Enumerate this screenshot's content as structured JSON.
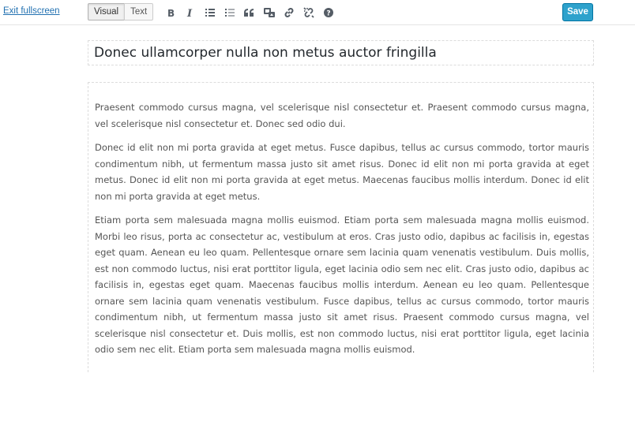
{
  "toolbar": {
    "exit_label": "Exit fullscreen",
    "modes": [
      {
        "label": "Visual",
        "active": true
      },
      {
        "label": "Text",
        "active": false
      }
    ],
    "icons": [
      "bold-icon",
      "italic-icon",
      "bulleted-list-icon",
      "numbered-list-icon",
      "blockquote-icon",
      "insert-media-icon",
      "insert-link-icon",
      "remove-link-icon",
      "help-icon"
    ],
    "save_label": "Save",
    "accent_color": "#2ea2cc"
  },
  "editor": {
    "title": "Donec ullamcorper nulla non metus auctor fringilla",
    "paragraphs": [
      "Praesent commodo cursus magna, vel scelerisque nisl consectetur et. Praesent commodo cursus magna, vel scelerisque nisl consectetur et. Donec sed odio dui.",
      "Donec id elit non mi porta gravida at eget metus. Fusce dapibus, tellus ac cursus commodo, tortor mauris condimentum nibh, ut fermentum massa justo sit amet risus. Donec id elit non mi porta gravida at eget metus. Donec id elit non mi porta gravida at eget metus. Maecenas faucibus mollis interdum. Donec id elit non mi porta gravida at eget metus.",
      "Etiam porta sem malesuada magna mollis euismod. Etiam porta sem malesuada magna mollis euismod. Morbi leo risus, porta ac consectetur ac, vestibulum at eros. Cras justo odio, dapibus ac facilisis in, egestas eget quam. Aenean eu leo quam. Pellentesque ornare sem lacinia quam venenatis vestibulum. Duis mollis, est non commodo luctus, nisi erat porttitor ligula, eget lacinia odio sem nec elit. Cras justo odio, dapibus ac facilisis in, egestas eget quam. Maecenas faucibus mollis interdum. Aenean eu leo quam. Pellentesque ornare sem lacinia quam venenatis vestibulum. Fusce dapibus, tellus ac cursus commodo, tortor mauris condimentum nibh, ut fermentum massa justo sit amet risus. Praesent commodo cursus magna, vel scelerisque nisl consectetur et. Duis mollis, est non commodo luctus, nisi erat porttitor ligula, eget lacinia odio sem nec elit. Etiam porta sem malesuada magna mollis euismod."
    ]
  }
}
